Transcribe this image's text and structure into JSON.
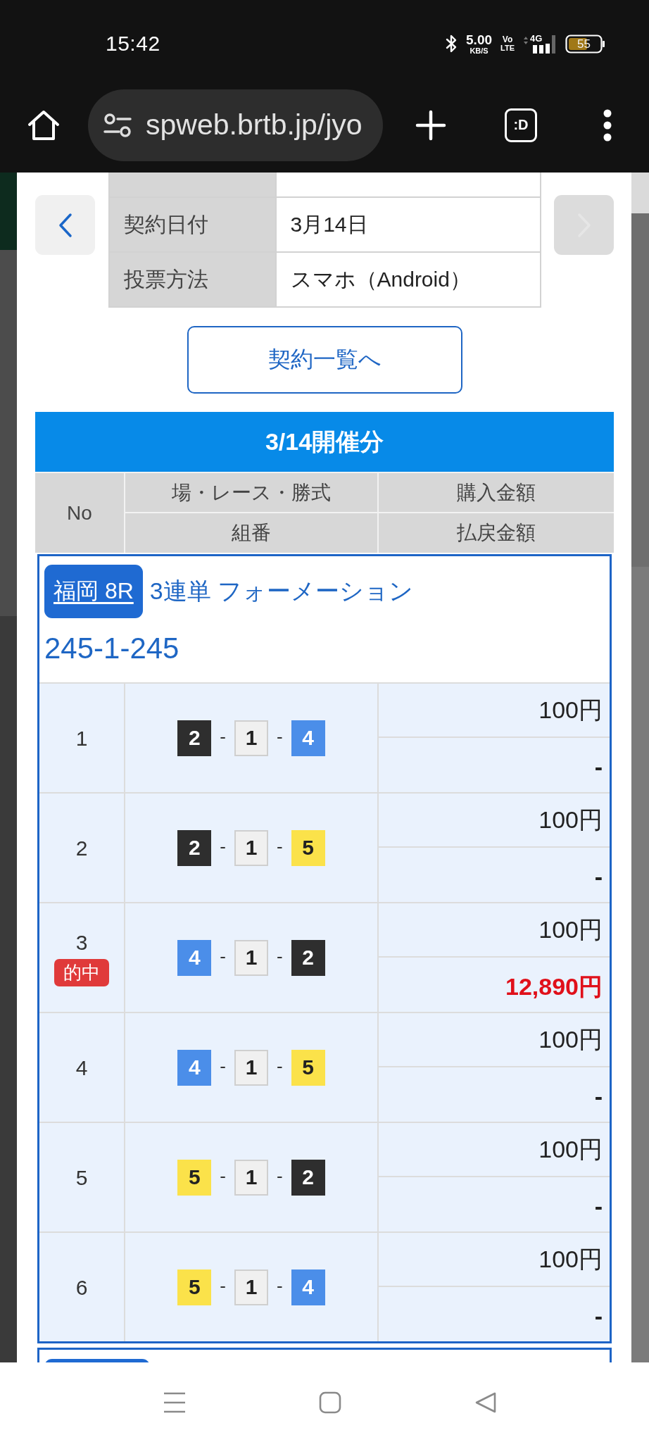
{
  "status_bar": {
    "time": "15:42",
    "net_speed": "5.00",
    "net_speed_unit": "KB/S",
    "volte_top": "Vo",
    "volte_bottom": "LTE",
    "network_type": "4G",
    "battery": "55"
  },
  "browser_toolbar": {
    "url": "spweb.brtb.jp/jyo",
    "tab_switcher": ":D"
  },
  "contract": {
    "prev_button": {
      "disabled": false
    },
    "next_button": {
      "disabled": true
    },
    "rows": [
      {
        "label": "契約日付",
        "value": "3月14日"
      },
      {
        "label": "投票方法",
        "value": "スマホ（Android）"
      }
    ],
    "list_button": "契約一覧へ"
  },
  "section": {
    "title": "3/14開催分",
    "columns": {
      "no": "No",
      "race": "場・レース・勝式",
      "combination": "組番",
      "purchase": "購入金額",
      "payout": "払戻金額"
    }
  },
  "groups": [
    {
      "venue": "福岡 8R",
      "bet_type": "3連単 フォーメーション",
      "formation": "245-1-245",
      "rows": [
        {
          "no": "1",
          "hit": false,
          "combo": [
            {
              "kind": "boat",
              "number": "2",
              "color": "#2e2e2e"
            },
            {
              "kind": "dash",
              "text": "-"
            },
            {
              "kind": "boat",
              "number": "1",
              "color": "#f0f0f0"
            },
            {
              "kind": "dash",
              "text": "-"
            },
            {
              "kind": "boat",
              "number": "4",
              "color": "#4b8ee9"
            }
          ],
          "purchase": "100円",
          "payout": "-"
        },
        {
          "no": "2",
          "hit": false,
          "combo": [
            {
              "kind": "boat",
              "number": "2",
              "color": "#2e2e2e"
            },
            {
              "kind": "dash",
              "text": "-"
            },
            {
              "kind": "boat",
              "number": "1",
              "color": "#f0f0f0"
            },
            {
              "kind": "dash",
              "text": "-"
            },
            {
              "kind": "boat",
              "number": "5",
              "color": "#fbe24a"
            }
          ],
          "purchase": "100円",
          "payout": "-"
        },
        {
          "no": "3",
          "hit": true,
          "badge": "的中",
          "combo": [
            {
              "kind": "boat",
              "number": "4",
              "color": "#4b8ee9"
            },
            {
              "kind": "dash",
              "text": "-"
            },
            {
              "kind": "boat",
              "number": "1",
              "color": "#f0f0f0"
            },
            {
              "kind": "dash",
              "text": "-"
            },
            {
              "kind": "boat",
              "number": "2",
              "color": "#2e2e2e"
            }
          ],
          "purchase": "100円",
          "payout": "12,890円"
        },
        {
          "no": "4",
          "hit": false,
          "combo": [
            {
              "kind": "boat",
              "number": "4",
              "color": "#4b8ee9"
            },
            {
              "kind": "dash",
              "text": "-"
            },
            {
              "kind": "boat",
              "number": "1",
              "color": "#f0f0f0"
            },
            {
              "kind": "dash",
              "text": "-"
            },
            {
              "kind": "boat",
              "number": "5",
              "color": "#fbe24a"
            }
          ],
          "purchase": "100円",
          "payout": "-"
        },
        {
          "no": "5",
          "hit": false,
          "combo": [
            {
              "kind": "boat",
              "number": "5",
              "color": "#fbe24a"
            },
            {
              "kind": "dash",
              "text": "-"
            },
            {
              "kind": "boat",
              "number": "1",
              "color": "#f0f0f0"
            },
            {
              "kind": "dash",
              "text": "-"
            },
            {
              "kind": "boat",
              "number": "2",
              "color": "#2e2e2e"
            }
          ],
          "purchase": "100円",
          "payout": "-"
        },
        {
          "no": "6",
          "hit": false,
          "combo": [
            {
              "kind": "boat",
              "number": "5",
              "color": "#fbe24a"
            },
            {
              "kind": "dash",
              "text": "-"
            },
            {
              "kind": "boat",
              "number": "1",
              "color": "#f0f0f0"
            },
            {
              "kind": "dash",
              "text": "-"
            },
            {
              "kind": "boat",
              "number": "4",
              "color": "#4b8ee9"
            }
          ],
          "purchase": "100円",
          "payout": "-"
        }
      ]
    }
  ],
  "more_below": true
}
